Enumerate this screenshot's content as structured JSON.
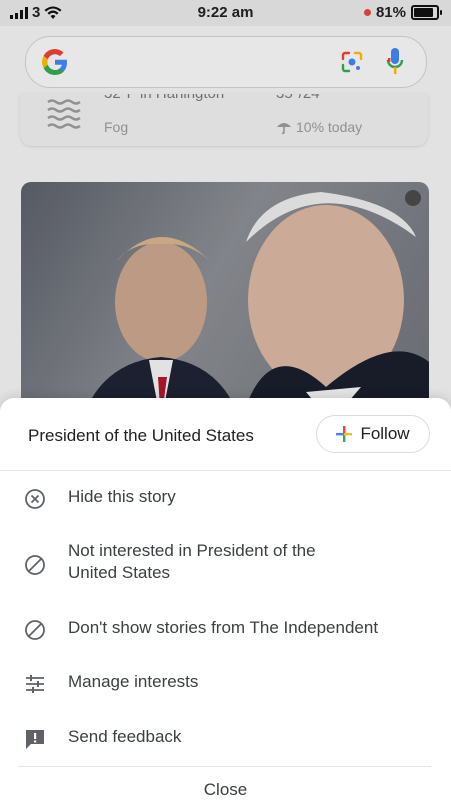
{
  "status_bar": {
    "carrier": "3",
    "time": "9:22 am",
    "battery": "81%"
  },
  "search": {
    "logo_text": "G",
    "icons": [
      "google-logo",
      "lens-icon",
      "mic-icon"
    ]
  },
  "weather": {
    "top_left_partial": "32°F in Harlington",
    "top_right_partial": "35°/24°",
    "condition": "Fog",
    "rain_chance": "10% today"
  },
  "sheet": {
    "topic": "President of the United States",
    "follow_label": "Follow",
    "items": [
      {
        "label": "Hide this story",
        "icon": "hide-x-icon"
      },
      {
        "label": "Not interested in President of the United States",
        "icon": "block-icon"
      },
      {
        "label": "Don't show stories from The Independent",
        "icon": "block-icon"
      },
      {
        "label": "Manage interests",
        "icon": "sliders-icon"
      },
      {
        "label": "Send feedback",
        "icon": "feedback-icon"
      }
    ],
    "close_label": "Close"
  },
  "colors": {
    "google_blue": "#4285f4",
    "google_red": "#ea4335",
    "google_yellow": "#fbbc05",
    "google_green": "#34a853",
    "text": "#3c4043"
  }
}
